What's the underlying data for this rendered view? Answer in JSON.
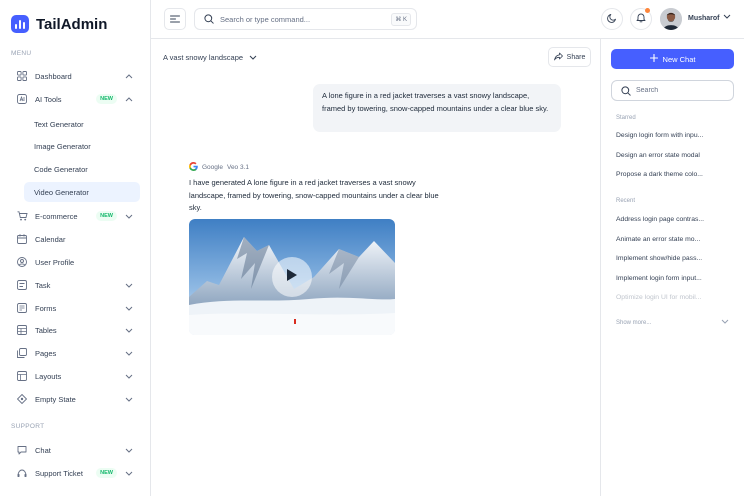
{
  "app": {
    "name": "TailAdmin",
    "brand_color": "#465fff"
  },
  "sidebar": {
    "menu_label": "MENU",
    "support_label": "SUPPORT",
    "items": [
      {
        "label": "Dashboard",
        "icon": "grid-icon",
        "chevron": "up"
      },
      {
        "label": "AI Tools",
        "icon": "ai-icon",
        "badge": "NEW",
        "chevron": "up"
      },
      {
        "label": "E-commerce",
        "icon": "cart-icon",
        "badge": "NEW",
        "chevron": "down"
      },
      {
        "label": "Calendar",
        "icon": "calendar-icon"
      },
      {
        "label": "User Profile",
        "icon": "user-circle-icon"
      },
      {
        "label": "Task",
        "icon": "task-icon",
        "chevron": "down"
      },
      {
        "label": "Forms",
        "icon": "forms-icon",
        "chevron": "down"
      },
      {
        "label": "Tables",
        "icon": "table-icon",
        "chevron": "down"
      },
      {
        "label": "Pages",
        "icon": "pages-icon",
        "chevron": "down"
      },
      {
        "label": "Layouts",
        "icon": "layouts-icon",
        "chevron": "down"
      },
      {
        "label": "Empty State",
        "icon": "empty-state-icon",
        "chevron": "down"
      }
    ],
    "ai_subitems": [
      "Text Generator",
      "Image Generator",
      "Code Generator",
      "Video Generator"
    ],
    "active_subitem": "Video Generator",
    "support_items": [
      {
        "label": "Chat",
        "icon": "chat-icon",
        "chevron": "down"
      },
      {
        "label": "Support Ticket",
        "icon": "ticket-icon",
        "badge": "NEW",
        "chevron": "down"
      }
    ]
  },
  "topbar": {
    "search_placeholder": "Search or type command...",
    "shortcut": "⌘ K",
    "user_name": "Musharof",
    "notification_dot_color": "#fd853a"
  },
  "chat": {
    "title": "A vast snowy landscape",
    "share_label": "Share",
    "user_message": "A lone figure in a red jacket traverses a vast snowy landscape, framed by towering, snow-capped mountains under a clear blue sky.",
    "ai_provider": "Google",
    "ai_model": "Veo 3.1",
    "ai_message": "I have generated A lone figure in a red jacket traverses a vast snowy landscape, framed by towering, snow-capped mountains under a clear blue sky."
  },
  "right_panel": {
    "new_chat_label": "New Chat",
    "search_placeholder": "Search",
    "starred_label": "Starred",
    "starred": [
      "Design login form with inpu...",
      "Design an error state modal",
      "Propose a dark theme colo..."
    ],
    "recent_label": "Recent",
    "recent": [
      "Address login page contras...",
      "Animate an error state mo...",
      "Implement show/hide pass...",
      "Implement login form input...",
      "Optimize login UI for mobil..."
    ],
    "show_more_label": "Show more..."
  }
}
